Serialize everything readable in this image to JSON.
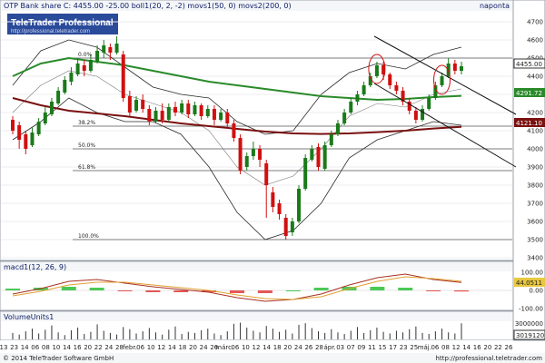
{
  "header": {
    "title": "OTP Bank share C: 4455.00 -25.00 boll1(20, 2, -2) movs1(50, 0) movs2(200, 0)",
    "period": "napontа"
  },
  "watermark": {
    "brand": "TeleTrader Professional",
    "url": "http://professional.teletrader.com"
  },
  "footer": {
    "copyright": "© 2014 TeleTrader Software GmbH",
    "url": "http://professional.teletrader.com"
  },
  "price_labels": {
    "last": "4455.00",
    "ma50": "4291.72",
    "ma200": "4121.10"
  },
  "macd_labels": {
    "title": "macd1(12, 26, 9)",
    "value": "44.0511"
  },
  "volume_labels": {
    "title": "VolumeUnits1",
    "value": "3019120"
  },
  "colors": {
    "background": "#ffffff",
    "panel_border": "#9aa0a8",
    "title_bar": "#f4f6f8",
    "up_candle": "#1a7a1a",
    "down_candle": "#d01010",
    "ma50": "#2a8a2a",
    "ma200": "#7a1010",
    "bollinger": "#2a2a2a",
    "trend_lines": "#111111",
    "circles": "#d01010",
    "macd_line": "#a83020",
    "macd_signal": "#e0a030",
    "macd_hist_pos": "#2ec03a",
    "macd_hist_neg": "#e03a3a"
  },
  "chart_data": {
    "type": "candlestick",
    "instrument": "OTP Bank share",
    "indicators": [
      "boll1(20, 2, -2)",
      "movs1(50, 0)",
      "movs2(200, 0)"
    ],
    "ylim": [
      3400,
      4750
    ],
    "y_ticks": [
      3400,
      3500,
      3600,
      3700,
      3800,
      3900,
      4000,
      4100,
      4200,
      4300,
      4400,
      4500,
      4600,
      4700
    ],
    "x_tick_labels": [
      "13",
      "23",
      "14",
      "06",
      "08",
      "10",
      "14",
      "16",
      "20",
      "22",
      "24",
      "28",
      "febr.",
      "06",
      "10",
      "12",
      "14",
      "18",
      "20",
      "24",
      "26",
      "márc.",
      "06",
      "10",
      "12",
      "14",
      "18",
      "20",
      "24",
      "26",
      "28",
      "ápr.",
      "03",
      "07",
      "09",
      "11",
      "15",
      "17",
      "23",
      "25",
      "máj.",
      "06",
      "08",
      "12",
      "14",
      "16",
      "20",
      "22",
      "26"
    ],
    "fibonacci_levels": [
      {
        "label": "0.0%",
        "value": 4500
      },
      {
        "label": "38.2%",
        "value": 4125
      },
      {
        "label": "50.0%",
        "value": 4000
      },
      {
        "label": "61.8%",
        "value": 3880
      },
      {
        "label": "100.0%",
        "value": 3500
      }
    ],
    "candles": [
      {
        "o": 4160,
        "c": 4100,
        "h": 4180,
        "l": 4080
      },
      {
        "o": 4130,
        "c": 4050,
        "h": 4150,
        "l": 4000
      },
      {
        "o": 4080,
        "c": 4000,
        "h": 4100,
        "l": 3970
      },
      {
        "o": 4020,
        "c": 4090,
        "h": 4120,
        "l": 4010
      },
      {
        "o": 4080,
        "c": 4150,
        "h": 4170,
        "l": 4070
      },
      {
        "o": 4140,
        "c": 4200,
        "h": 4230,
        "l": 4130
      },
      {
        "o": 4190,
        "c": 4260,
        "h": 4280,
        "l": 4180
      },
      {
        "o": 4250,
        "c": 4320,
        "h": 4340,
        "l": 4240
      },
      {
        "o": 4310,
        "c": 4380,
        "h": 4400,
        "l": 4300
      },
      {
        "o": 4370,
        "c": 4420,
        "h": 4450,
        "l": 4350
      },
      {
        "o": 4410,
        "c": 4470,
        "h": 4500,
        "l": 4400
      },
      {
        "o": 4460,
        "c": 4430,
        "h": 4490,
        "l": 4400
      },
      {
        "o": 4430,
        "c": 4490,
        "h": 4520,
        "l": 4420
      },
      {
        "o": 4480,
        "c": 4540,
        "h": 4570,
        "l": 4470
      },
      {
        "o": 4530,
        "c": 4570,
        "h": 4600,
        "l": 4500
      },
      {
        "o": 4560,
        "c": 4530,
        "h": 4580,
        "l": 4490
      },
      {
        "o": 4530,
        "c": 4580,
        "h": 4620,
        "l": 4520
      },
      {
        "o": 4520,
        "c": 4280,
        "h": 4540,
        "l": 4260
      },
      {
        "o": 4290,
        "c": 4200,
        "h": 4320,
        "l": 4180
      },
      {
        "o": 4210,
        "c": 4270,
        "h": 4290,
        "l": 4200
      },
      {
        "o": 4270,
        "c": 4220,
        "h": 4300,
        "l": 4200
      },
      {
        "o": 4220,
        "c": 4150,
        "h": 4240,
        "l": 4130
      },
      {
        "o": 4150,
        "c": 4210,
        "h": 4230,
        "l": 4140
      },
      {
        "o": 4210,
        "c": 4160,
        "h": 4250,
        "l": 4140
      },
      {
        "o": 4160,
        "c": 4230,
        "h": 4250,
        "l": 4150
      },
      {
        "o": 4230,
        "c": 4200,
        "h": 4260,
        "l": 4180
      },
      {
        "o": 4200,
        "c": 4250,
        "h": 4270,
        "l": 4190
      },
      {
        "o": 4250,
        "c": 4190,
        "h": 4270,
        "l": 4170
      },
      {
        "o": 4190,
        "c": 4240,
        "h": 4260,
        "l": 4180
      },
      {
        "o": 4240,
        "c": 4180,
        "h": 4250,
        "l": 4160
      },
      {
        "o": 4180,
        "c": 4220,
        "h": 4240,
        "l": 4170
      },
      {
        "o": 4220,
        "c": 4160,
        "h": 4240,
        "l": 4130
      },
      {
        "o": 4160,
        "c": 4200,
        "h": 4220,
        "l": 4150
      },
      {
        "o": 4200,
        "c": 4140,
        "h": 4220,
        "l": 4120
      },
      {
        "o": 4140,
        "c": 4060,
        "h": 4160,
        "l": 4040
      },
      {
        "o": 4060,
        "c": 3880,
        "h": 4080,
        "l": 3860
      },
      {
        "o": 3900,
        "c": 3960,
        "h": 3980,
        "l": 3880
      },
      {
        "o": 3960,
        "c": 4000,
        "h": 4040,
        "l": 3940
      },
      {
        "o": 4000,
        "c": 3940,
        "h": 4020,
        "l": 3900
      },
      {
        "o": 3920,
        "c": 3800,
        "h": 3940,
        "l": 3620
      },
      {
        "o": 3760,
        "c": 3680,
        "h": 3790,
        "l": 3650
      },
      {
        "o": 3700,
        "c": 3640,
        "h": 3720,
        "l": 3610
      },
      {
        "o": 3620,
        "c": 3520,
        "h": 3640,
        "l": 3500
      },
      {
        "o": 3540,
        "c": 3600,
        "h": 3620,
        "l": 3520
      },
      {
        "o": 3600,
        "c": 3780,
        "h": 3800,
        "l": 3590
      },
      {
        "o": 3780,
        "c": 3950,
        "h": 3970,
        "l": 3770
      },
      {
        "o": 3940,
        "c": 4000,
        "h": 4020,
        "l": 3930
      },
      {
        "o": 4010,
        "c": 3900,
        "h": 4030,
        "l": 3880
      },
      {
        "o": 3890,
        "c": 4020,
        "h": 4040,
        "l": 3880
      },
      {
        "o": 4020,
        "c": 4080,
        "h": 4100,
        "l": 4010
      },
      {
        "o": 4080,
        "c": 4140,
        "h": 4160,
        "l": 4070
      },
      {
        "o": 4140,
        "c": 4200,
        "h": 4220,
        "l": 4130
      },
      {
        "o": 4200,
        "c": 4260,
        "h": 4280,
        "l": 4190
      },
      {
        "o": 4260,
        "c": 4300,
        "h": 4320,
        "l": 4240
      },
      {
        "o": 4300,
        "c": 4350,
        "h": 4370,
        "l": 4290
      },
      {
        "o": 4350,
        "c": 4400,
        "h": 4420,
        "l": 4340
      },
      {
        "o": 4400,
        "c": 4460,
        "h": 4480,
        "l": 4390
      },
      {
        "o": 4460,
        "c": 4410,
        "h": 4480,
        "l": 4380
      },
      {
        "o": 4410,
        "c": 4350,
        "h": 4420,
        "l": 4330
      },
      {
        "o": 4350,
        "c": 4320,
        "h": 4370,
        "l": 4300
      },
      {
        "o": 4320,
        "c": 4260,
        "h": 4340,
        "l": 4240
      },
      {
        "o": 4260,
        "c": 4210,
        "h": 4280,
        "l": 4190
      },
      {
        "o": 4210,
        "c": 4160,
        "h": 4230,
        "l": 4140
      },
      {
        "o": 4160,
        "c": 4220,
        "h": 4240,
        "l": 4150
      },
      {
        "o": 4220,
        "c": 4280,
        "h": 4300,
        "l": 4210
      },
      {
        "o": 4280,
        "c": 4350,
        "h": 4370,
        "l": 4270
      },
      {
        "o": 4350,
        "c": 4400,
        "h": 4420,
        "l": 4340
      },
      {
        "o": 4400,
        "c": 4470,
        "h": 4500,
        "l": 4390
      },
      {
        "o": 4470,
        "c": 4430,
        "h": 4490,
        "l": 4410
      },
      {
        "o": 4430,
        "c": 4455,
        "h": 4480,
        "l": 4410
      }
    ],
    "ma50": [
      4400,
      4470,
      4500,
      4480,
      4460,
      4430,
      4400,
      4370,
      4350,
      4330,
      4310,
      4290,
      4280,
      4270,
      4275,
      4285,
      4292
    ],
    "ma200": [
      4280,
      4240,
      4210,
      4195,
      4180,
      4160,
      4140,
      4125,
      4110,
      4095,
      4085,
      4082,
      4085,
      4092,
      4100,
      4112,
      4121
    ],
    "boll_upper": [
      4350,
      4540,
      4600,
      4560,
      4450,
      4340,
      4300,
      4280,
      4150,
      4080,
      4100,
      4300,
      4420,
      4470,
      4440,
      4520,
      4560
    ],
    "boll_mid": [
      4200,
      4350,
      4430,
      4400,
      4300,
      4250,
      4200,
      4100,
      3900,
      3800,
      3850,
      4000,
      4180,
      4250,
      4230,
      4300,
      4330
    ],
    "boll_lower": [
      4050,
      4150,
      4280,
      4200,
      4150,
      4150,
      4080,
      3900,
      3650,
      3500,
      3550,
      3700,
      3950,
      4050,
      4100,
      4150,
      4130
    ],
    "trendlines": [
      {
        "from": [
          57,
          4620
        ],
        "to": [
          80,
          4190
        ]
      },
      {
        "from": [
          57,
          4360
        ],
        "to": [
          80,
          3900
        ]
      }
    ],
    "circled_peaks": [
      56,
      66
    ],
    "macd": {
      "ylim": [
        -100,
        100
      ],
      "y_ticks": [
        100,
        0,
        -100
      ],
      "line": [
        -20,
        10,
        50,
        60,
        40,
        20,
        5,
        -10,
        -40,
        -60,
        -50,
        -20,
        30,
        70,
        90,
        60,
        44
      ],
      "signal": [
        -30,
        -5,
        30,
        45,
        45,
        30,
        15,
        0,
        -25,
        -45,
        -50,
        -35,
        10,
        50,
        75,
        65,
        50
      ],
      "hist": [
        10,
        15,
        20,
        15,
        -5,
        -10,
        -10,
        -10,
        -15,
        -15,
        0,
        15,
        20,
        20,
        15,
        -5,
        -6
      ]
    },
    "volume": {
      "y_ticks": [
        3000000,
        1000000
      ],
      "values": [
        1.2,
        0.9,
        1.5,
        2.0,
        1.1,
        1.8,
        2.6,
        1.3,
        0.8,
        1.7,
        2.2,
        1.0,
        1.4,
        2.8,
        1.6,
        1.2,
        0.9,
        2.3,
        1.9,
        1.1,
        1.5,
        2.1,
        1.3,
        0.9,
        1.8,
        2.4,
        1.0,
        1.4,
        1.2,
        1.7,
        2.0,
        1.1,
        0.8,
        1.5,
        2.9,
        3.1,
        2.2,
        1.6,
        1.3,
        2.5,
        2.0,
        1.4,
        1.8,
        1.1,
        2.7,
        3.0,
        2.1,
        1.5,
        1.2,
        1.9,
        1.3,
        1.0,
        1.6,
        2.3,
        1.2,
        1.7,
        2.2,
        1.4,
        1.1,
        1.6,
        1.3,
        1.9,
        2.4,
        1.2,
        1.0,
        1.5,
        2.0,
        1.3,
        1.1,
        3.0
      ]
    }
  }
}
